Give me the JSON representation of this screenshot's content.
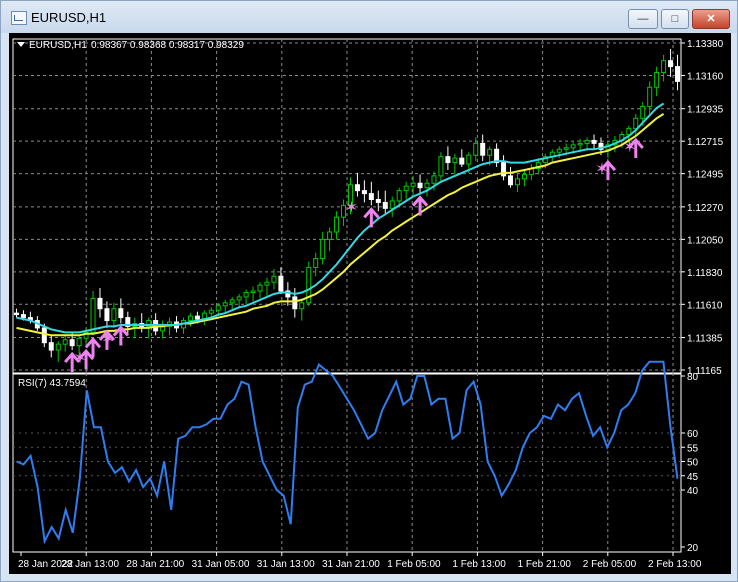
{
  "window": {
    "title": "EURUSD,H1",
    "buttons": {
      "minimize": "—",
      "maximize": "□",
      "close": "✕"
    }
  },
  "colors": {
    "background": "#000000",
    "grid": "#8a8a8a",
    "bull_candle": "#00c800",
    "bear_candle": "#ffffff",
    "ma_fast": "#32d8e6",
    "ma_slow": "#f2f23a",
    "rsi": "#2f7df0",
    "arrows": "#ee82ee",
    "text": "#ffffff"
  },
  "chart_data": [
    {
      "type": "candlestick",
      "title": "EURUSD,H1",
      "ohlc_text": "0.98367 0.98368 0.98317 0.98329",
      "ylim": [
        1.11165,
        1.1338
      ],
      "ytick_labels": [
        "1.13380",
        "1.13160",
        "1.12935",
        "1.12715",
        "1.12495",
        "1.12270",
        "1.12050",
        "1.11830",
        "1.11610",
        "1.11385",
        "1.11165"
      ],
      "xtick_labels": [
        "28 Jan 2022",
        "28 Jan 13:00",
        "28 Jan 21:00",
        "31 Jan 05:00",
        "31 Jan 13:00",
        "31 Jan 21:00",
        "1 Feb 05:00",
        "1 Feb 13:00",
        "1 Feb 21:00",
        "2 Feb 05:00",
        "2 Feb 13:00"
      ],
      "grid": true,
      "ohlc": [
        [
          1.1155,
          1.1158,
          1.1152,
          1.1154
        ],
        [
          1.1154,
          1.1157,
          1.115,
          1.1152
        ],
        [
          1.1152,
          1.1156,
          1.1148,
          1.115
        ],
        [
          1.115,
          1.1153,
          1.1143,
          1.1145
        ],
        [
          1.1145,
          1.1148,
          1.1132,
          1.1135
        ],
        [
          1.1135,
          1.114,
          1.1125,
          1.113
        ],
        [
          1.113,
          1.1136,
          1.1122,
          1.1134
        ],
        [
          1.1134,
          1.114,
          1.1129,
          1.1137
        ],
        [
          1.1137,
          1.1142,
          1.113,
          1.1133
        ],
        [
          1.1133,
          1.114,
          1.1127,
          1.1138
        ],
        [
          1.1138,
          1.1145,
          1.1132,
          1.1142
        ],
        [
          1.1142,
          1.117,
          1.114,
          1.1165
        ],
        [
          1.1165,
          1.1172,
          1.1152,
          1.1158
        ],
        [
          1.1158,
          1.1163,
          1.1145,
          1.115
        ],
        [
          1.115,
          1.1162,
          1.1145,
          1.1158
        ],
        [
          1.1158,
          1.1165,
          1.1148,
          1.1152
        ],
        [
          1.1152,
          1.1156,
          1.114,
          1.1146
        ],
        [
          1.1146,
          1.1152,
          1.1138,
          1.1148
        ],
        [
          1.1148,
          1.1155,
          1.1142,
          1.1146
        ],
        [
          1.1146,
          1.1152,
          1.1138,
          1.115
        ],
        [
          1.115,
          1.1155,
          1.114,
          1.1143
        ],
        [
          1.1143,
          1.115,
          1.1138,
          1.1146
        ],
        [
          1.1146,
          1.1152,
          1.114,
          1.1149
        ],
        [
          1.1149,
          1.1153,
          1.1142,
          1.1145
        ],
        [
          1.1145,
          1.1152,
          1.1141,
          1.115
        ],
        [
          1.115,
          1.1155,
          1.1146,
          1.1153
        ],
        [
          1.1153,
          1.1156,
          1.1148,
          1.1151
        ],
        [
          1.1151,
          1.1157,
          1.1147,
          1.1155
        ],
        [
          1.1155,
          1.1159,
          1.115,
          1.1157
        ],
        [
          1.1157,
          1.1162,
          1.1153,
          1.116
        ],
        [
          1.116,
          1.1164,
          1.1155,
          1.1162
        ],
        [
          1.1162,
          1.1166,
          1.1157,
          1.1164
        ],
        [
          1.1164,
          1.1168,
          1.1159,
          1.1166
        ],
        [
          1.1166,
          1.1171,
          1.1161,
          1.1169
        ],
        [
          1.1169,
          1.1173,
          1.1163,
          1.117
        ],
        [
          1.117,
          1.1176,
          1.1165,
          1.1174
        ],
        [
          1.1174,
          1.1179,
          1.1167,
          1.1176
        ],
        [
          1.1176,
          1.1185,
          1.1171,
          1.118
        ],
        [
          1.118,
          1.1186,
          1.1168,
          1.117
        ],
        [
          1.117,
          1.1176,
          1.116,
          1.1166
        ],
        [
          1.1166,
          1.1172,
          1.1152,
          1.1158
        ],
        [
          1.1158,
          1.1165,
          1.115,
          1.1162
        ],
        [
          1.1162,
          1.119,
          1.116,
          1.1186
        ],
        [
          1.1186,
          1.1196,
          1.118,
          1.1192
        ],
        [
          1.1192,
          1.121,
          1.1188,
          1.1205
        ],
        [
          1.1205,
          1.1213,
          1.1197,
          1.121
        ],
        [
          1.121,
          1.1224,
          1.1205,
          1.122
        ],
        [
          1.122,
          1.1232,
          1.1214,
          1.1228
        ],
        [
          1.1228,
          1.1247,
          1.1222,
          1.1242
        ],
        [
          1.1242,
          1.125,
          1.1234,
          1.1238
        ],
        [
          1.1238,
          1.1245,
          1.123,
          1.1236
        ],
        [
          1.1236,
          1.1244,
          1.1228,
          1.1232
        ],
        [
          1.1232,
          1.1238,
          1.1224,
          1.123
        ],
        [
          1.123,
          1.1238,
          1.1222,
          1.1226
        ],
        [
          1.1226,
          1.1234,
          1.122,
          1.1231
        ],
        [
          1.1231,
          1.124,
          1.1227,
          1.1238
        ],
        [
          1.1238,
          1.1244,
          1.1232,
          1.1241
        ],
        [
          1.1241,
          1.1248,
          1.1235,
          1.1243
        ],
        [
          1.1243,
          1.1249,
          1.1236,
          1.124
        ],
        [
          1.124,
          1.1246,
          1.1234,
          1.1243
        ],
        [
          1.1243,
          1.1251,
          1.1238,
          1.1248
        ],
        [
          1.1248,
          1.1264,
          1.1244,
          1.1261
        ],
        [
          1.1261,
          1.1268,
          1.1252,
          1.1257
        ],
        [
          1.1257,
          1.1263,
          1.1249,
          1.126
        ],
        [
          1.126,
          1.1266,
          1.1254,
          1.1256
        ],
        [
          1.1256,
          1.1264,
          1.125,
          1.1262
        ],
        [
          1.1262,
          1.1274,
          1.1258,
          1.127
        ],
        [
          1.127,
          1.1276,
          1.1258,
          1.1262
        ],
        [
          1.1262,
          1.1268,
          1.1255,
          1.1266
        ],
        [
          1.1266,
          1.127,
          1.1254,
          1.1257
        ],
        [
          1.1257,
          1.1262,
          1.1245,
          1.1248
        ],
        [
          1.1248,
          1.1254,
          1.124,
          1.1242
        ],
        [
          1.1242,
          1.125,
          1.1237,
          1.1246
        ],
        [
          1.1246,
          1.1252,
          1.1241,
          1.1249
        ],
        [
          1.1249,
          1.1256,
          1.1245,
          1.1253
        ],
        [
          1.1253,
          1.126,
          1.1249,
          1.1257
        ],
        [
          1.1257,
          1.1263,
          1.1253,
          1.1261
        ],
        [
          1.1261,
          1.1266,
          1.1257,
          1.1264
        ],
        [
          1.1264,
          1.1268,
          1.126,
          1.1266
        ],
        [
          1.1266,
          1.127,
          1.1262,
          1.1267
        ],
        [
          1.1267,
          1.1271,
          1.1263,
          1.1269
        ],
        [
          1.1269,
          1.1273,
          1.1264,
          1.127
        ],
        [
          1.127,
          1.1274,
          1.1265,
          1.1272
        ],
        [
          1.1272,
          1.1276,
          1.1266,
          1.127
        ],
        [
          1.127,
          1.1274,
          1.1262,
          1.1266
        ],
        [
          1.1266,
          1.1272,
          1.126,
          1.1269
        ],
        [
          1.1269,
          1.1275,
          1.1264,
          1.1272
        ],
        [
          1.1272,
          1.1278,
          1.1267,
          1.1276
        ],
        [
          1.1276,
          1.1282,
          1.127,
          1.128
        ],
        [
          1.128,
          1.129,
          1.1275,
          1.1287
        ],
        [
          1.1287,
          1.1298,
          1.1282,
          1.1295
        ],
        [
          1.1295,
          1.1312,
          1.129,
          1.1308
        ],
        [
          1.1308,
          1.1322,
          1.1302,
          1.1318
        ],
        [
          1.1318,
          1.133,
          1.1312,
          1.1326
        ],
        [
          1.1326,
          1.1334,
          1.1315,
          1.1322
        ],
        [
          1.1322,
          1.133,
          1.1306,
          1.1312
        ]
      ],
      "series": [
        {
          "values": [
            1.1152,
            1.1151,
            1.115,
            1.1148,
            1.1146,
            1.1144,
            1.1143,
            1.1142,
            1.1142,
            1.1142,
            1.1143,
            1.1144,
            1.1145,
            1.1146,
            1.1146,
            1.1147,
            1.1147,
            1.1147,
            1.1147,
            1.1147,
            1.1147,
            1.1147,
            1.1147,
            1.1147,
            1.1148,
            1.1149,
            1.115,
            1.1151,
            1.1152,
            1.1154,
            1.1155,
            1.1157,
            1.1159,
            1.116,
            1.1162,
            1.1164,
            1.1166,
            1.1168,
            1.1169,
            1.1169,
            1.1168,
            1.1169,
            1.1171,
            1.1174,
            1.1178,
            1.1183,
            1.1188,
            1.1194,
            1.12,
            1.1206,
            1.1211,
            1.1215,
            1.1219,
            1.1222,
            1.1225,
            1.1228,
            1.1231,
            1.1234,
            1.1236,
            1.1238,
            1.1241,
            1.1244,
            1.1246,
            1.1248,
            1.125,
            1.1252,
            1.1254,
            1.1256,
            1.1257,
            1.1258,
            1.1258,
            1.1257,
            1.1257,
            1.1257,
            1.1258,
            1.1259,
            1.126,
            1.1261,
            1.1262,
            1.1263,
            1.1264,
            1.1265,
            1.1266,
            1.1266,
            1.1267,
            1.1268,
            1.127,
            1.1272,
            1.1275,
            1.1279,
            1.1284,
            1.1289,
            1.1294,
            1.1297
          ]
        },
        {
          "values": [
            1.1145,
            1.1144,
            1.1143,
            1.1142,
            1.1141,
            1.114,
            1.114,
            1.114,
            1.114,
            1.114,
            1.1141,
            1.1141,
            1.1142,
            1.1143,
            1.1143,
            1.1144,
            1.1144,
            1.1145,
            1.1145,
            1.1145,
            1.1146,
            1.1146,
            1.1147,
            1.1147,
            1.1148,
            1.1148,
            1.1149,
            1.115,
            1.1151,
            1.1152,
            1.1153,
            1.1154,
            1.1155,
            1.1156,
            1.1158,
            1.1159,
            1.116,
            1.1162,
            1.1163,
            1.1163,
            1.1163,
            1.1164,
            1.1166,
            1.1168,
            1.1171,
            1.1175,
            1.1179,
            1.1183,
            1.1188,
            1.1192,
            1.1196,
            1.12,
            1.1204,
            1.1207,
            1.1211,
            1.1214,
            1.1217,
            1.122,
            1.1223,
            1.1226,
            1.1229,
            1.1232,
            1.1235,
            1.1237,
            1.124,
            1.1242,
            1.1244,
            1.1246,
            1.1248,
            1.1249,
            1.125,
            1.125,
            1.1251,
            1.1252,
            1.1253,
            1.1254,
            1.1255,
            1.1257,
            1.1258,
            1.1259,
            1.126,
            1.1261,
            1.1262,
            1.1263,
            1.1264,
            1.1265,
            1.1267,
            1.1269,
            1.1272,
            1.1275,
            1.1279,
            1.1283,
            1.1287,
            1.129
          ]
        }
      ],
      "arrows_up": [
        8,
        10,
        11,
        13,
        15,
        51,
        58,
        85,
        89
      ],
      "stars": [
        10,
        14,
        49,
        85,
        89
      ]
    },
    {
      "type": "line",
      "title": "RSI(7) 43.7594",
      "ylim": [
        20,
        80
      ],
      "ytick_labels": [
        "80",
        "60",
        "55",
        "50",
        "45",
        "40",
        "20"
      ],
      "values": [
        50,
        49,
        52,
        41,
        22,
        27,
        23,
        33,
        25,
        44,
        75,
        62,
        62,
        50,
        46,
        48,
        43,
        47,
        41,
        44,
        38,
        50,
        33,
        58,
        59,
        62,
        62,
        63,
        65,
        65,
        70,
        72,
        78,
        77,
        62,
        50,
        45,
        40,
        38,
        28,
        69,
        77,
        78,
        84,
        82,
        80,
        76,
        72,
        68,
        63,
        58,
        60,
        68,
        73,
        78,
        70,
        72,
        80,
        80,
        70,
        72,
        72,
        58,
        60,
        75,
        78,
        70,
        50,
        45,
        38,
        42,
        47,
        55,
        60,
        62,
        66,
        65,
        70,
        68,
        72,
        74,
        66,
        59,
        62,
        55,
        60,
        68,
        70,
        74,
        82,
        85,
        88,
        92,
        62,
        44
      ]
    }
  ]
}
